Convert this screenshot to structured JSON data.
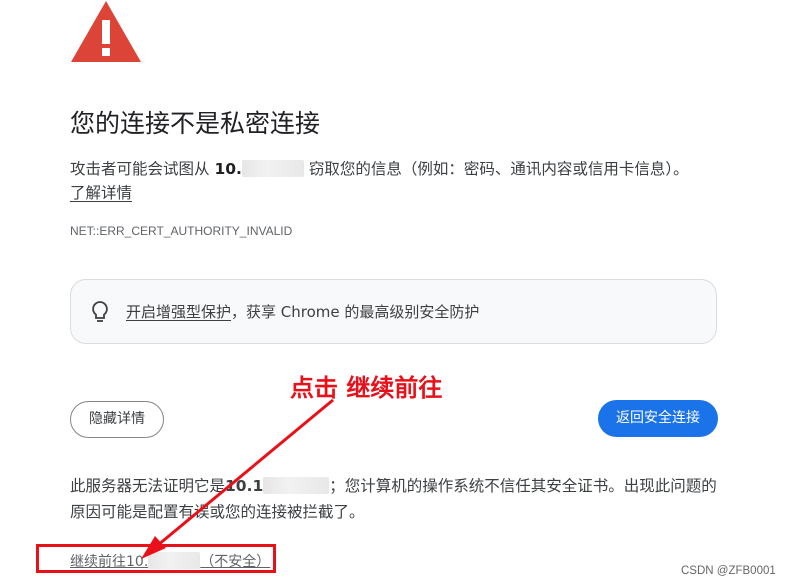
{
  "page": {
    "title": "您的连接不是私密连接",
    "attack_text_prefix": "攻击者可能会试图从",
    "host_prefix": "10.",
    "attack_text_suffix": "窃取您的信息（例如：密码、通讯内容或信用卡信息）。",
    "learn_more": "了解详情",
    "error_code": "NET::ERR_CERT_AUTHORITY_INVALID",
    "protect_link": "开启增强型保护",
    "protect_suffix": "，获享 Chrome 的最高级别安全防护",
    "hide_details_button": "隐藏详情",
    "back_to_safety_button": "返回安全连接",
    "details_prefix": "此服务器无法证明它是",
    "details_host": "10.1",
    "details_text": "；您计算机的操作系统不信任其安全证书。出现此问题的原因可能是配置有误或您的连接被拦截了。",
    "proceed_prefix": "继续前往10.",
    "proceed_suffix": "（不安全）"
  },
  "annotation": {
    "text": "点击 继续前往",
    "color": "#e8111a"
  },
  "colors": {
    "warning_red": "#db4437",
    "primary_blue": "#1a73e8"
  },
  "icons": {
    "warning": "warning-triangle-icon",
    "bulb": "lightbulb-icon"
  },
  "watermark": "CSDN @ZFB0001"
}
